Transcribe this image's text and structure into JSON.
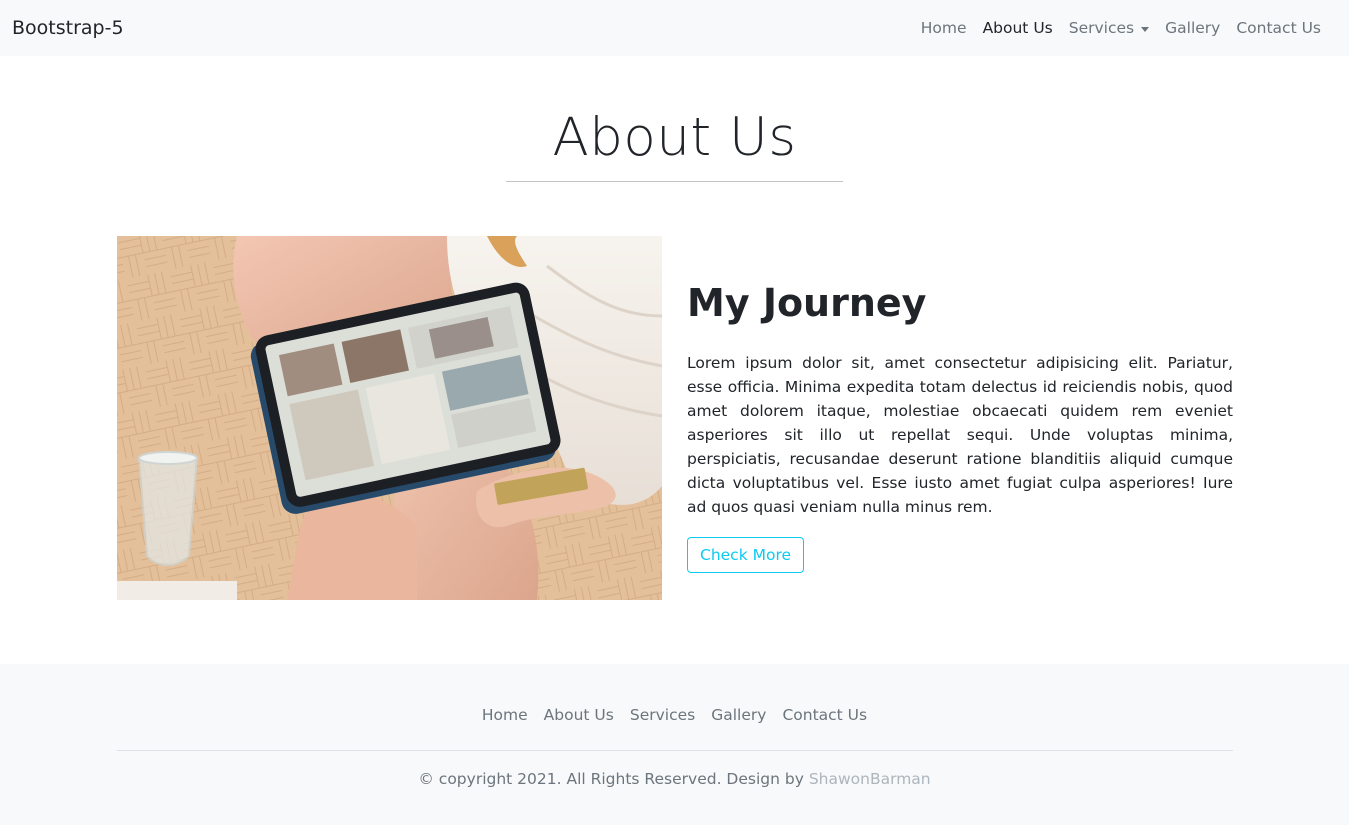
{
  "navbar": {
    "brand": "Bootstrap-5",
    "items": [
      {
        "label": "Home"
      },
      {
        "label": "About Us"
      },
      {
        "label": "Services"
      },
      {
        "label": "Gallery"
      },
      {
        "label": "Contact Us"
      }
    ]
  },
  "page": {
    "title": "About Us"
  },
  "about": {
    "image_icon": "photo-woman-tablet",
    "heading": "My Journey",
    "body": "Lorem ipsum dolor sit, amet consectetur adipisicing elit. Pariatur, esse officia. Minima expedita totam delectus id reiciendis nobis, quod amet dolorem itaque, molestiae obcaecati quidem rem eveniet asperiores sit illo ut repellat sequi. Unde voluptas minima, perspiciatis, recusandae deserunt ratione blanditiis aliquid cumque dicta voluptatibus vel. Esse iusto amet fugiat culpa asperiores! Iure ad quos quasi veniam nulla minus rem.",
    "button_label": "Check More"
  },
  "footer": {
    "links": [
      {
        "label": "Home"
      },
      {
        "label": "About Us"
      },
      {
        "label": "Services"
      },
      {
        "label": "Gallery"
      },
      {
        "label": "Contact Us"
      }
    ],
    "copyright_text": "© copyright 2021. All Rights Reserved. Design by ",
    "designer": "ShawonBarman"
  },
  "colors": {
    "navbar_bg": "#f8f9fa",
    "accent": "#0dcaf0",
    "muted": "#6c757d"
  }
}
